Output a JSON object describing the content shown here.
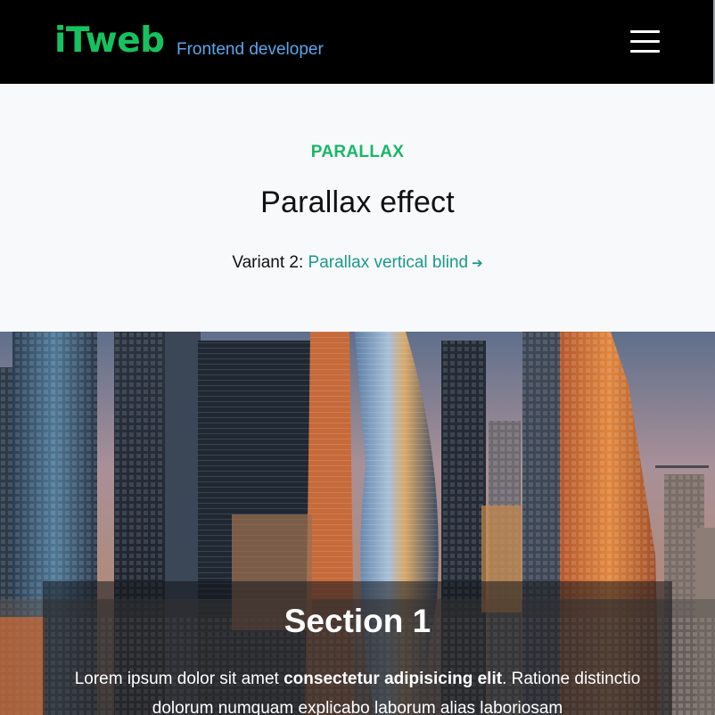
{
  "header": {
    "logo": "iTweb",
    "tagline": "Frontend developer",
    "menu_icon": "hamburger-menu-icon"
  },
  "intro": {
    "eyebrow": "PARALLAX",
    "title": "Parallax effect",
    "variant_prefix": "Variant 2: ",
    "variant_link": "Parallax vertical blind",
    "variant_arrow": "➔"
  },
  "hero": {
    "image": "city-skyline-photo",
    "section_title": "Section 1",
    "text_part1": "Lorem ipsum dolor sit amet ",
    "text_bold": "consectetur adipisicing elit",
    "text_part2": ". Ratione distinctio dolorum numquam explicabo laborum alias laboriosam"
  },
  "colors": {
    "brand_green": "#16c25f",
    "tagline_blue": "#5aa7ec",
    "link_teal": "#1a9a8a",
    "header_bg": "#000000",
    "page_bg": "#f8f9fb"
  }
}
